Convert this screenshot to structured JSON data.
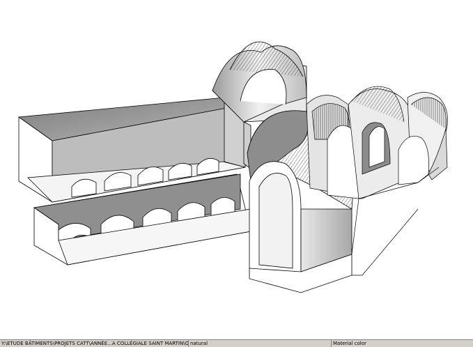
{
  "viewport": {
    "model": "church-3d-model",
    "background": "#ffffff",
    "stroke": "#000000",
    "shade_dark": "#8f8f8f",
    "shade_mid": "#b5b5b5",
    "shade_light": "#e2e2e2"
  },
  "statusbar": {
    "file_path": "Y:\\ETUDE BÂTIMENTS\\PROJETS CATT\\ANNÉE...A COLLÉGIALE SAINT MARTIN\\OUT\\Shaded.OGL",
    "lighting_mode": "natural",
    "color_mode": "Material color"
  }
}
